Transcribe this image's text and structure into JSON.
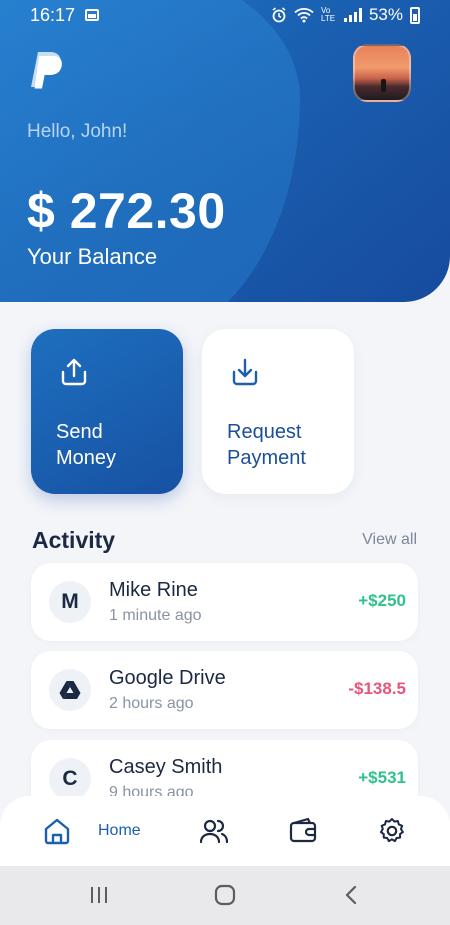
{
  "status_bar": {
    "time": "16:17",
    "battery": "53%",
    "network_label": "Vo LTE"
  },
  "header": {
    "greeting": "Hello, John!",
    "balance": "$ 272.30",
    "balance_label": "Your Balance"
  },
  "actions": {
    "send": {
      "line1": "Send",
      "line2": "Money",
      "icon": "upload-icon"
    },
    "request": {
      "line1": "Request",
      "line2": "Payment",
      "icon": "download-icon"
    }
  },
  "activity": {
    "title": "Activity",
    "view_all": "View all",
    "items": [
      {
        "initial": "M",
        "name": "Mike Rine",
        "time": "1 minute ago",
        "amount": "+$250",
        "type": "credit"
      },
      {
        "initial": "",
        "icon": "google-drive-icon",
        "name": "Google Drive",
        "time": "2 hours ago",
        "amount": "-$138.5",
        "type": "debit"
      },
      {
        "initial": "C",
        "name": "Casey Smith",
        "time": "9 hours ago",
        "amount": "+$531",
        "type": "credit"
      }
    ]
  },
  "bottom_nav": {
    "home_label": "Home",
    "items": [
      "home-icon",
      "contacts-icon",
      "wallet-icon",
      "settings-icon"
    ]
  },
  "colors": {
    "primary": "#1a5fb0",
    "credit": "#2fc28a",
    "debit": "#e8557a",
    "background": "#f3f5f9"
  }
}
